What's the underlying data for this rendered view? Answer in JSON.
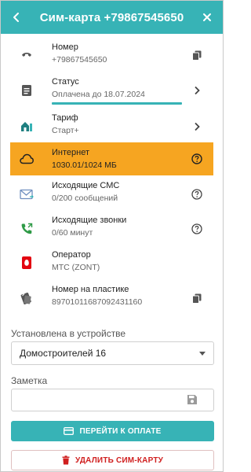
{
  "header": {
    "title": "Сим-карта +79867545650"
  },
  "rows": {
    "number": {
      "label": "Номер",
      "value": "+79867545650"
    },
    "status": {
      "label": "Статус",
      "value": "Оплачена до 18.07.2024"
    },
    "tariff": {
      "label": "Тариф",
      "value": "Старт+"
    },
    "internet": {
      "label": "Интернет",
      "value": "1030.01/1024 МБ"
    },
    "sms": {
      "label": "Исходящие СМС",
      "value": "0/200 сообщений"
    },
    "calls": {
      "label": "Исходящие звонки",
      "value": "0/60 минут"
    },
    "operator": {
      "label": "Оператор",
      "value": "МТС (ZONT)"
    },
    "plastic": {
      "label": "Номер на пластике",
      "value": "89701011687092431160"
    }
  },
  "device": {
    "label": "Установлена в устройстве",
    "selected": "Домостроителей 16"
  },
  "note": {
    "label": "Заметка",
    "value": ""
  },
  "buttons": {
    "pay": "ПЕРЕЙТИ К ОПЛАТЕ",
    "delete": "УДАЛИТЬ СИМ-КАРТУ"
  },
  "colors": {
    "accent": "#37b3b6",
    "internet_warning": "#f6a521",
    "danger": "#d01f1f"
  },
  "icons": {
    "back": "arrow-left-icon",
    "close": "close-icon",
    "number": "phone-icon",
    "status": "document-icon",
    "tariff": "tariff-icon",
    "internet": "cloud-icon",
    "sms": "envelope-icon",
    "calls": "outgoing-call-icon",
    "operator": "mts-logo-icon",
    "plastic": "sim-card-icon",
    "copy": "copy-icon",
    "chevron": "chevron-right-icon",
    "help": "help-icon",
    "save": "save-icon",
    "card": "credit-card-icon",
    "trash": "trash-icon"
  }
}
